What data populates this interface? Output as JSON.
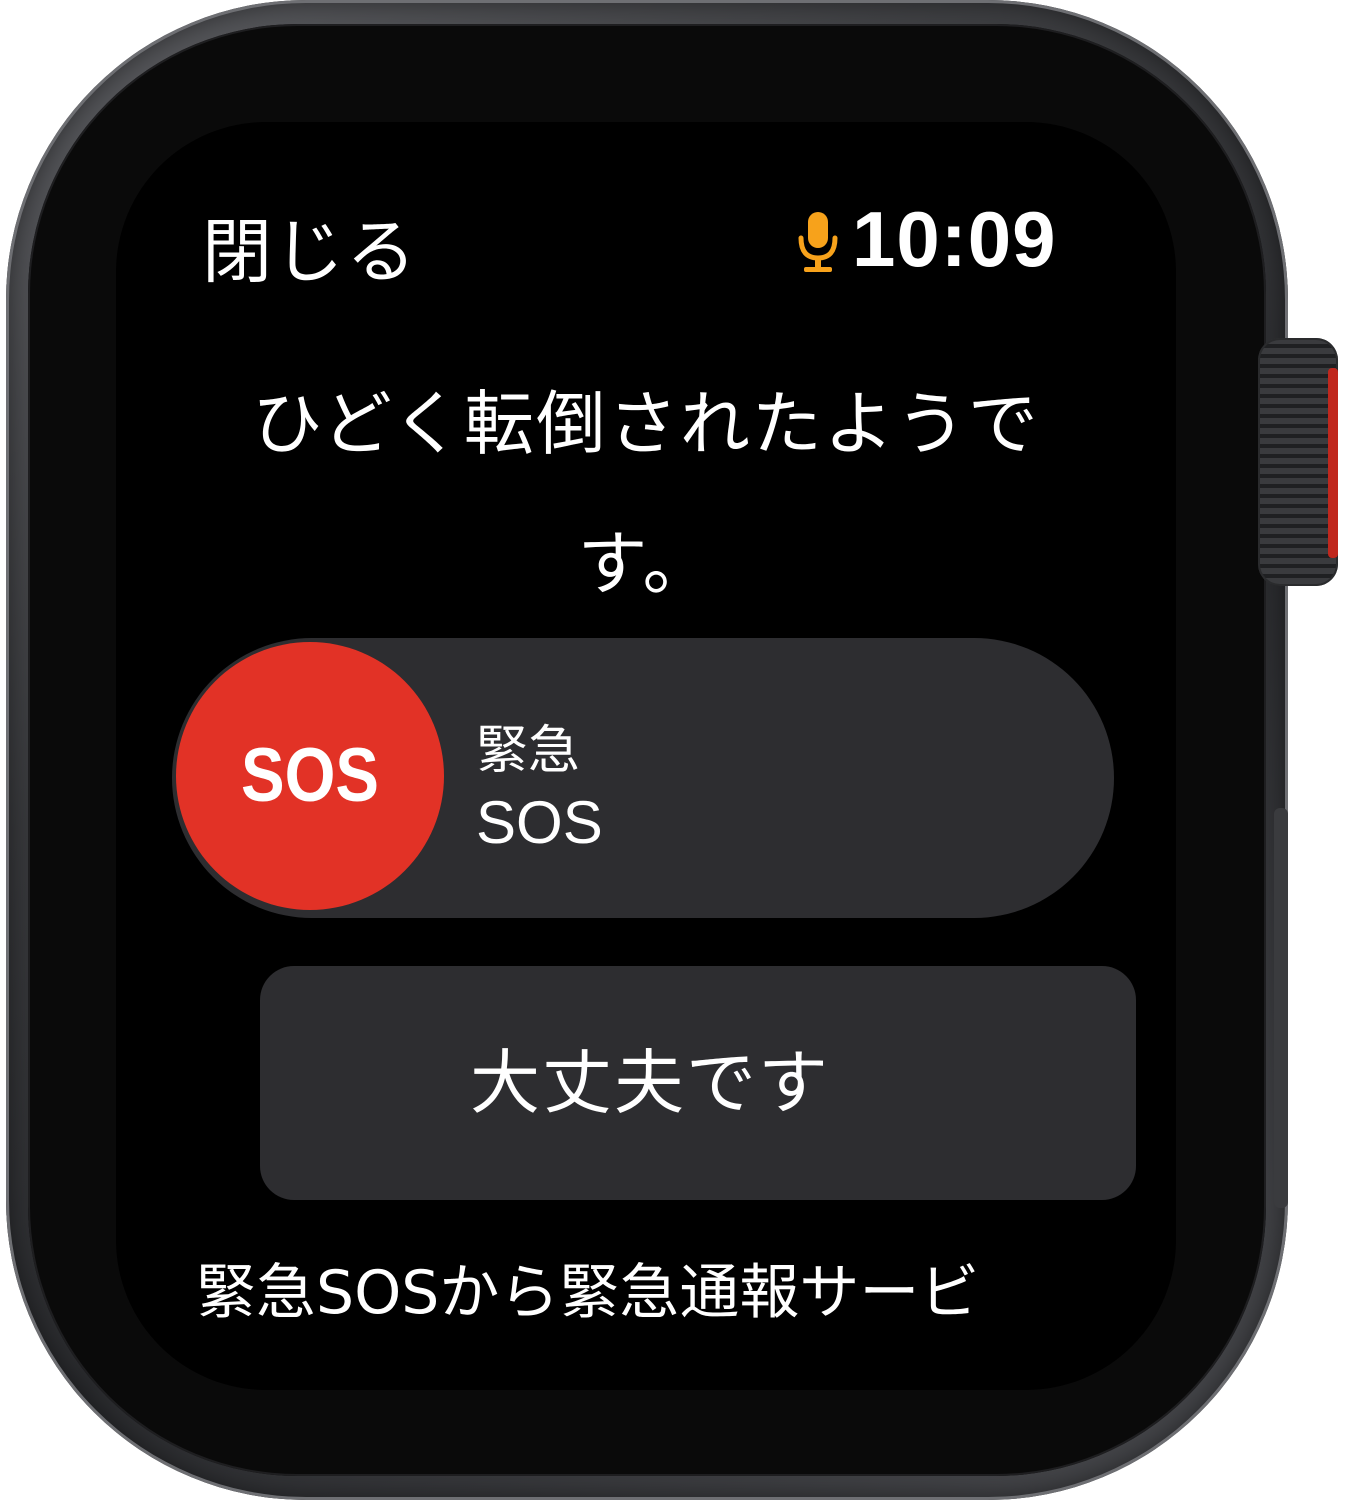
{
  "header": {
    "close_label": "閉じる",
    "time": "10:09",
    "mic_icon": "microphone-icon",
    "mic_color": "#f7a21b"
  },
  "alert": {
    "message": "ひどく転倒されたようです。"
  },
  "sos_slider": {
    "knob_label": "SOS",
    "label_line1": "緊急",
    "label_line2": "SOS",
    "knob_color": "#e23226"
  },
  "ok_button": {
    "label": "大丈夫です"
  },
  "footer": {
    "text": "緊急SOSから緊急通報サービ"
  }
}
